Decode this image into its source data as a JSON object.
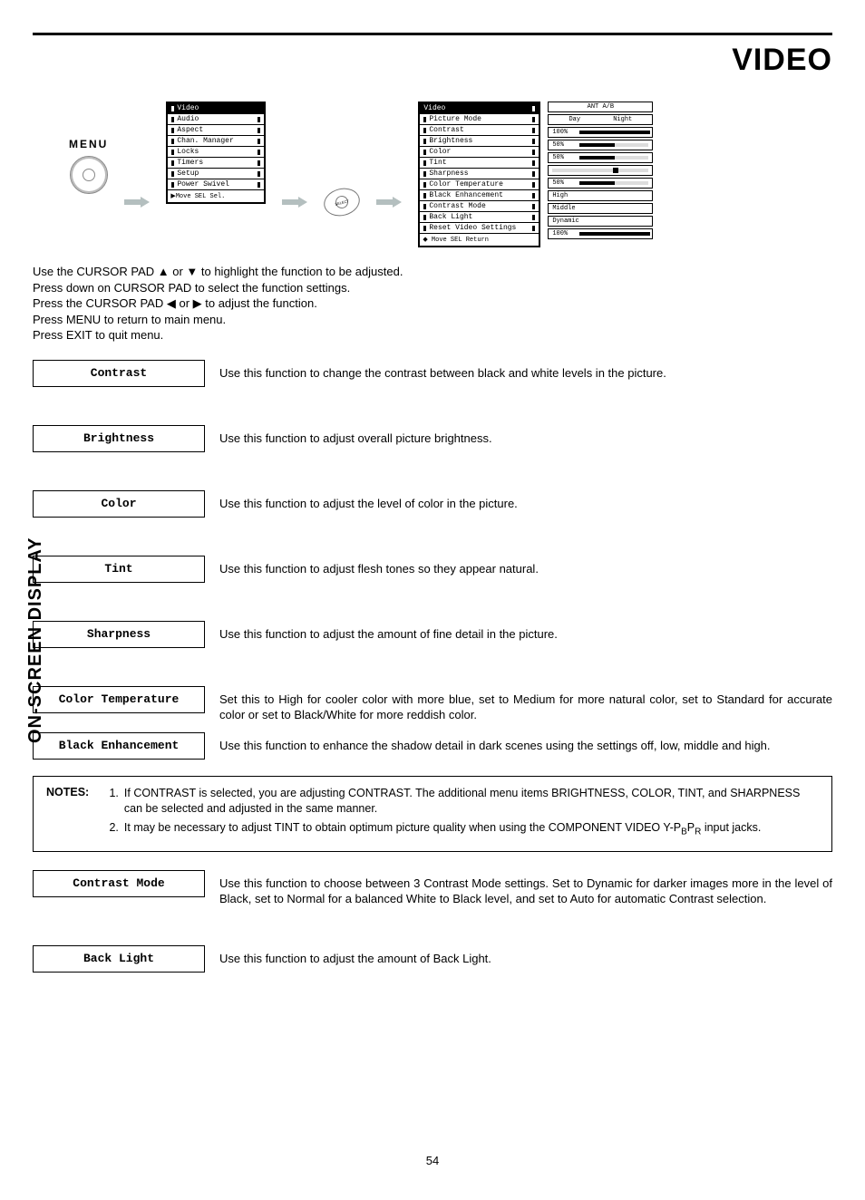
{
  "page_title": "VIDEO",
  "sidebar_label": "ON-SCREEN DISPLAY",
  "page_number": "54",
  "menu_label": "MENU",
  "select_label": "SELECT",
  "left_panel": {
    "items": [
      "Video",
      "Audio",
      "Aspect",
      "Chan. Manager",
      "Locks",
      "Timers",
      "Setup",
      "Power Swivel"
    ],
    "footer": "▶Move  SEL Sel."
  },
  "right_panel": {
    "header_label": "Video",
    "items": [
      "Picture Mode",
      "Contrast",
      "Brightness",
      "Color",
      "Tint",
      "Sharpness",
      "Color Temperature",
      "Black Enhancement",
      "Contrast Mode",
      "Back Light",
      "Reset Video Settings"
    ],
    "footer": "◆ Move  SEL Return"
  },
  "value_header": {
    "left": "ANT A/B"
  },
  "values": [
    {
      "left": "Day",
      "right": "Night"
    },
    {
      "label": "100%",
      "pct": 100
    },
    {
      "label": "50%",
      "pct": 50
    },
    {
      "label": "50%",
      "pct": 50
    },
    {
      "tint": true,
      "pos": 62
    },
    {
      "label": "50%",
      "pct": 50
    },
    {
      "text": "High"
    },
    {
      "text": "Middle"
    },
    {
      "text": "Dynamic"
    },
    {
      "label": "100%",
      "pct": 100
    }
  ],
  "instructions": [
    "Use the CURSOR PAD ▲ or ▼ to highlight the function to be adjusted.",
    "Press down on CURSOR PAD to select the function settings.",
    "Press the CURSOR PAD ◀ or ▶ to adjust the function.",
    "Press MENU to return to main menu.",
    "Press EXIT to quit menu."
  ],
  "defs": [
    {
      "label": "Contrast",
      "text": "Use this function to change the contrast between black and white levels in the picture."
    },
    {
      "label": "Brightness",
      "text": "Use this function to adjust overall picture brightness."
    },
    {
      "label": "Color",
      "text": "Use this function to adjust the level of color in the picture."
    },
    {
      "label": "Tint",
      "text": "Use this function to adjust flesh tones so they appear natural."
    },
    {
      "label": "Sharpness",
      "text": "Use this function to adjust the amount of fine detail in the picture."
    },
    {
      "label": "Color Temperature",
      "text": "Set this to High for cooler color with more blue, set to Medium for more natural color, set to Standard for accurate color or set to Black/White for more reddish color."
    },
    {
      "label": "Black Enhancement",
      "text": "Use this function to enhance the shadow detail in dark scenes using the settings off, low, middle and high."
    }
  ],
  "notes_label": "NOTES:",
  "notes": [
    "If CONTRAST is selected, you are adjusting CONTRAST.  The additional menu items BRIGHTNESS, COLOR, TINT, and SHARPNESS can be selected and adjusted in the same manner.",
    "It may be necessary to adjust TINT to obtain optimum picture quality when using the COMPONENT VIDEO Y-PBPR input jacks."
  ],
  "defs2": [
    {
      "label": "Contrast Mode",
      "text": "Use this function to choose between 3 Contrast Mode settings.  Set to Dynamic for darker images more in the level of Black, set to Normal for a balanced White to Black level, and set to Auto for automatic Contrast selection."
    },
    {
      "label": "Back Light",
      "text": "Use this function to adjust the amount of Back Light."
    }
  ]
}
